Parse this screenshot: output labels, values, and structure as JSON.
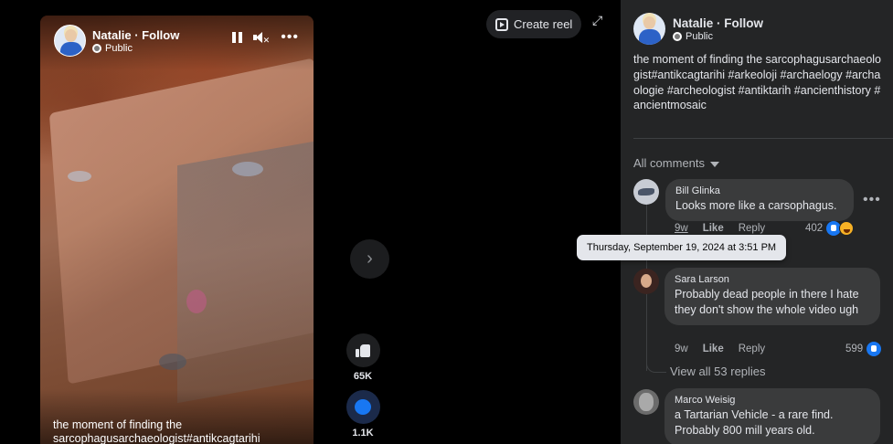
{
  "top_bar": {
    "create_reel_label": "Create reel",
    "expand_icon": "expand-icon"
  },
  "video": {
    "author_name": "Natalie · Follow",
    "visibility": "Public",
    "caption_overlay": "the moment of finding the sarcophagusarchaeologist#antikcagtarihi",
    "controls": [
      "pause-icon",
      "mute-icon",
      "more-icon"
    ]
  },
  "actions": {
    "like_count": "65K",
    "comment_count": "1.1K"
  },
  "navigation": {
    "next_icon": "chevron-right-icon"
  },
  "post": {
    "author_name": "Natalie · Follow",
    "visibility": "Public",
    "caption": "the moment of finding the sarcophagusarchaeologist#antikcagtarihi #arkeoloji #archaelogy #archaologie #archeologist #antiktarih #ancienthistory #ancientmosaic"
  },
  "comments_header": {
    "label": "All comments"
  },
  "comments": [
    {
      "author": "Bill Glinka",
      "text": "Looks more like a carsophagus.",
      "time": "9w",
      "like_label": "Like",
      "reply_label": "Reply",
      "reaction_count": "402"
    },
    {
      "author": "Sara Larson",
      "text": "Probably dead people in there I hate they don't show the whole video ugh",
      "time": "9w",
      "like_label": "Like",
      "reply_label": "Reply",
      "reaction_count": "599"
    },
    {
      "author": "Marco Weisig",
      "text": "a Tartarian Vehicle - a rare find. Probably 800 mill years old."
    }
  ],
  "view_replies_label": "View all 53 replies",
  "tooltip": {
    "text": "Thursday, September 19, 2024 at 3:51 PM"
  },
  "colors": {
    "panel_bg": "#242526",
    "bubble_bg": "#3a3b3c",
    "accent_blue": "#1877f2",
    "text_primary": "#e4e6eb",
    "text_secondary": "#b0b3b8"
  }
}
